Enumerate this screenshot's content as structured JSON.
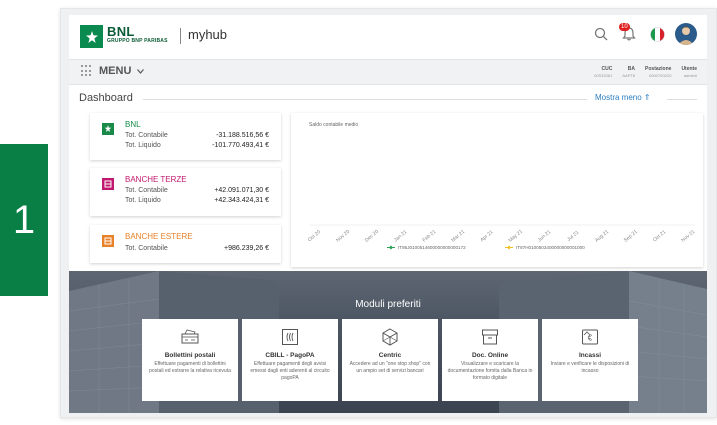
{
  "slide_number": "1",
  "header": {
    "brand_name": "BNL",
    "brand_sub": "GRUPPO BNP PARIBAS",
    "app_name": "myhub",
    "notification_count": "10"
  },
  "menubar": {
    "menu_label": "MENU",
    "meta": [
      {
        "label": "CUC",
        "value": "00S32061"
      },
      {
        "label": "BA",
        "value": "AAPT8"
      },
      {
        "label": "Postazione",
        "value": "0000700Z20"
      },
      {
        "label": "Utente",
        "value": "admin0"
      }
    ]
  },
  "dashboard": {
    "title": "Dashboard",
    "show_more": "Mostra meno ⇑"
  },
  "banks": [
    {
      "name": "BNL",
      "color": "#1a8a4a",
      "rows": [
        {
          "label": "Tot. Contabile",
          "value": "-31.188.516,56 €"
        },
        {
          "label": "Tot. Liquido",
          "value": "-101.770.493,41 €"
        }
      ]
    },
    {
      "name": "BANCHE TERZE",
      "color": "#c0186e",
      "rows": [
        {
          "label": "Tot. Contabile",
          "value": "+42.091.071,30 €"
        },
        {
          "label": "Tot. Liquido",
          "value": "+42.343.424,31 €"
        }
      ]
    },
    {
      "name": "BANCHE ESTERE",
      "color": "#e8822a",
      "rows": [
        {
          "label": "Tot. Contabile",
          "value": "+986.239,26 €"
        }
      ]
    }
  ],
  "chart_data": {
    "type": "line",
    "title": "Saldo contabile medio",
    "categories": [
      "Oct 20",
      "Nov 20",
      "Dec 20",
      "Jan 21",
      "Feb 21",
      "Mar 21",
      "Apr 21",
      "May 21",
      "Jun 21",
      "Jul 21",
      "Aug 21",
      "Sep 21",
      "Oct 21",
      "Nov 21"
    ],
    "series": [
      {
        "name": "IT86J0100514600000000000172",
        "color": "#2aa05a"
      },
      {
        "name": "IT87H0100503400000000001000",
        "color": "#f0c020"
      }
    ]
  },
  "modules": {
    "title": "Moduli preferiti",
    "items": [
      {
        "name": "Bollettini postali",
        "desc": "Effettuare pagamenti di bollettini postali ed estrarre la relativa ricevuta",
        "icon": "postal-slip-icon"
      },
      {
        "name": "CBILL - PagoPA",
        "desc": "Effettuare pagamenti degli avvisi emessi dagli enti aderenti al circuito pagoPA",
        "icon": "cbill-icon"
      },
      {
        "name": "Centric",
        "desc": "Accedere ad un \"one stop shop\" con un ampio set di servizi bancari",
        "icon": "cube-icon"
      },
      {
        "name": "Doc. Online",
        "desc": "Visualizzare e scaricare la documentazione fornita dalla Banca in formato digitale",
        "icon": "archive-box-icon"
      },
      {
        "name": "Incassi",
        "desc": "Inviare e verificare le disposizioni di incasso",
        "icon": "cash-in-icon"
      }
    ]
  }
}
